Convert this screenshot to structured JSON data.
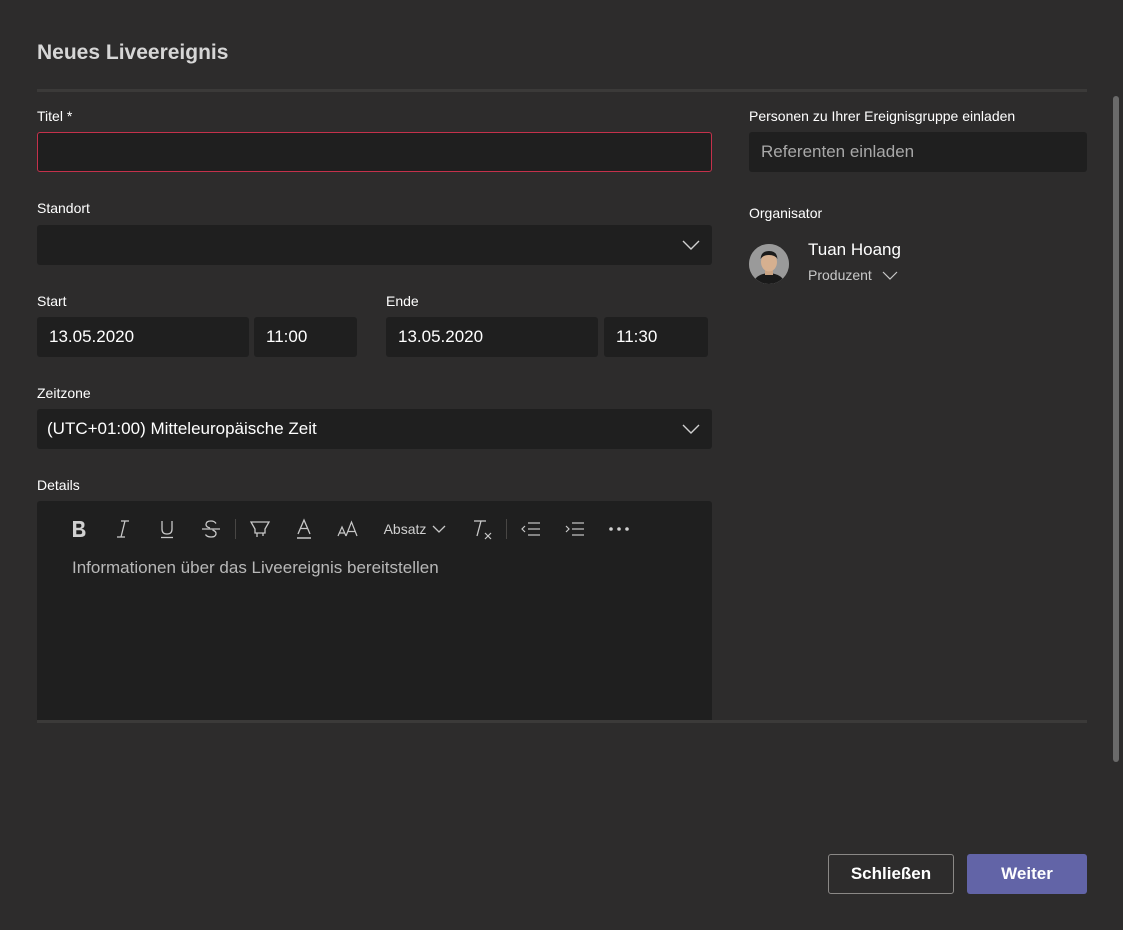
{
  "dialog": {
    "title": "Neues Liveereignis"
  },
  "form": {
    "title_label": "Titel *",
    "title_value": "",
    "location_label": "Standort",
    "location_value": "",
    "start_label": "Start",
    "start_date": "13.05.2020",
    "start_time": "11:00",
    "end_label": "Ende",
    "end_date": "13.05.2020",
    "end_time": "11:30",
    "timezone_label": "Zeitzone",
    "timezone_value": "(UTC+01:00) Mitteleuropäische Zeit",
    "details_label": "Details",
    "details_placeholder": "Informationen über das Liveereignis bereitstellen"
  },
  "editor_toolbar": {
    "paragraph_label": "Absatz"
  },
  "sidebar": {
    "invite_label": "Personen zu Ihrer Ereignisgruppe einladen",
    "invite_placeholder": "Referenten einladen",
    "organizer_label": "Organisator",
    "organizer_name": "Tuan Hoang",
    "organizer_role": "Produzent"
  },
  "footer": {
    "close_label": "Schließen",
    "next_label": "Weiter"
  },
  "colors": {
    "background": "#2d2c2c",
    "field": "#1f1f1f",
    "accent": "#6264a7",
    "error_border": "#c4314b"
  },
  "icons": [
    "chevron-down-icon",
    "bold-icon",
    "italic-icon",
    "underline-icon",
    "strikethrough-icon",
    "highlight-icon",
    "font-color-icon",
    "font-size-icon",
    "clear-format-icon",
    "decrease-indent-icon",
    "increase-indent-icon",
    "more-options-icon"
  ]
}
